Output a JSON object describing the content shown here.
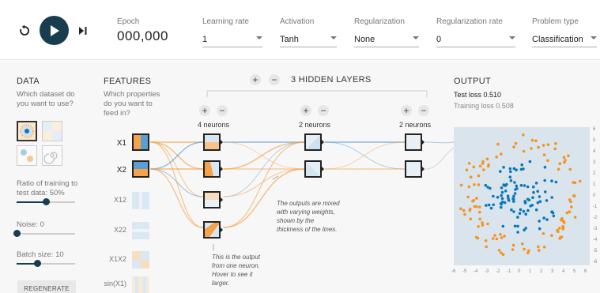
{
  "top": {
    "epoch_label": "Epoch",
    "epoch_value": "000,000",
    "learning_rate": {
      "label": "Learning rate",
      "value": "1"
    },
    "activation": {
      "label": "Activation",
      "value": "Tanh"
    },
    "regularization": {
      "label": "Regularization",
      "value": "None"
    },
    "regularization_rate": {
      "label": "Regularization rate",
      "value": "0"
    },
    "problem_type": {
      "label": "Problem type",
      "value": "Classification"
    }
  },
  "data": {
    "title": "DATA",
    "question": "Which dataset do you want to use?",
    "ratio_label": "Ratio of training to test data:",
    "ratio_value": "50%",
    "noise_label": "Noise:",
    "noise_value": "0",
    "batch_label": "Batch size:",
    "batch_value": "10",
    "regenerate": "REGENERATE",
    "ratio_fraction": 0.5,
    "noise_fraction": 0,
    "batch_fraction": 0.35
  },
  "features": {
    "title": "FEATURES",
    "question": "Which properties do you want to feed in?",
    "items": [
      "X1",
      "X2",
      "X12",
      "X22",
      "X1X2",
      "sin(X1)"
    ]
  },
  "layers": {
    "count": "3",
    "label": "HIDDEN LAYERS",
    "neuron_labels": [
      "4 neurons",
      "2 neurons",
      "2 neurons"
    ]
  },
  "notes": {
    "weights": "The outputs are mixed with varying weights, shown by the thickness of the lines.",
    "neuron": "This is the output from one neuron. Hover to see it larger."
  },
  "output": {
    "title": "OUTPUT",
    "test_loss_label": "Test loss",
    "test_loss": "0.510",
    "training_loss_label": "Training loss",
    "training_loss": "0.508",
    "x_ticks": [
      "-6",
      "-5",
      "-4",
      "-3",
      "-2",
      "-1",
      "0",
      "1",
      "2",
      "3",
      "4",
      "5",
      "6"
    ],
    "y_ticks": [
      "6",
      "5",
      "4",
      "3",
      "2",
      "1",
      "0",
      "-1",
      "-2",
      "-3",
      "-4",
      "-5",
      "-6"
    ]
  },
  "colors": {
    "orange": "#f59322",
    "blue": "#0877bd",
    "dark": "#183d4e",
    "plot_bg": "#d9e4ec"
  }
}
